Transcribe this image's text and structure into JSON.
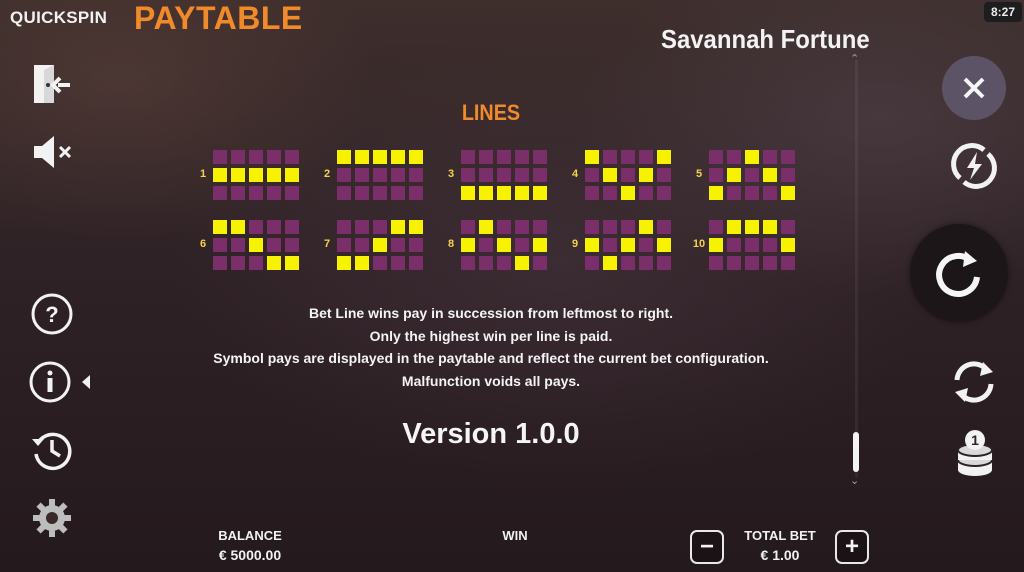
{
  "header": {
    "brand": "QUICKSPIN",
    "page_title": "PAYTABLE",
    "game_title": "Savannah Fortune",
    "clock": "8:27"
  },
  "left_bar": {
    "icons": [
      "exit-icon",
      "sound-muted-icon",
      "help-icon",
      "info-icon",
      "history-icon",
      "settings-icon"
    ]
  },
  "right_bar": {
    "icons": [
      "close-icon",
      "turbo-icon",
      "spin-icon",
      "autoplay-icon",
      "coins-icon"
    ]
  },
  "lines": {
    "title": "LINES",
    "items": [
      {
        "label": "1",
        "rows": [
          1,
          1,
          1,
          1,
          1
        ]
      },
      {
        "label": "2",
        "rows": [
          0,
          0,
          0,
          0,
          0
        ]
      },
      {
        "label": "3",
        "rows": [
          2,
          2,
          2,
          2,
          2
        ]
      },
      {
        "label": "4",
        "rows": [
          0,
          1,
          2,
          1,
          0
        ]
      },
      {
        "label": "5",
        "rows": [
          2,
          1,
          0,
          1,
          2
        ]
      },
      {
        "label": "6",
        "rows": [
          0,
          0,
          1,
          2,
          2
        ]
      },
      {
        "label": "7",
        "rows": [
          2,
          2,
          1,
          0,
          0
        ]
      },
      {
        "label": "8",
        "rows": [
          1,
          0,
          1,
          2,
          1
        ]
      },
      {
        "label": "9",
        "rows": [
          1,
          2,
          1,
          0,
          1
        ]
      },
      {
        "label": "10",
        "rows": [
          1,
          0,
          0,
          0,
          1
        ]
      }
    ]
  },
  "rules": [
    "Bet Line wins pay in succession from leftmost to right.",
    "Only the highest win per line is paid.",
    "Symbol pays are displayed in the paytable and reflect the current bet configuration.",
    "Malfunction voids all pays."
  ],
  "version": "Version 1.0.0",
  "footer": {
    "balance_label": "BALANCE",
    "balance_value": "€ 5000.00",
    "win_label": "WIN",
    "total_bet_label": "TOTAL BET",
    "total_bet_value": "€ 1.00",
    "minus_label": "−",
    "plus_label": "+"
  },
  "colors": {
    "accent": "#f08a2a",
    "line_on": "#f7f200",
    "line_off": "#7a2e6a"
  }
}
